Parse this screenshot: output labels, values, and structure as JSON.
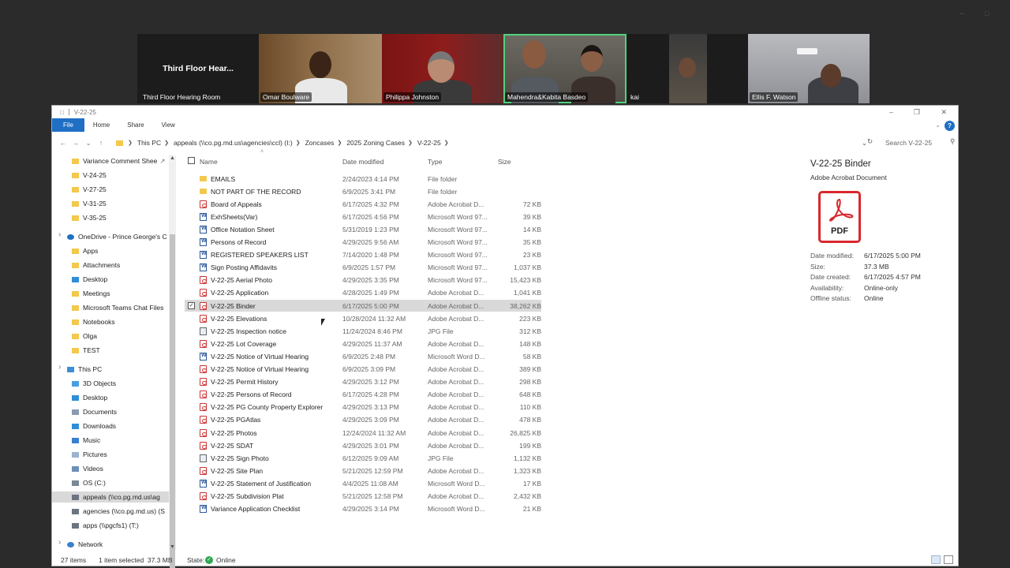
{
  "meeting": {
    "room_title": "Third Floor Hear...",
    "tiles": [
      "Third Floor Hearing Room",
      "Omar Boulware",
      "Philippa Johnston",
      "Mahendra&Kabita Basdeo",
      "kai",
      "Ellis F. Watson"
    ]
  },
  "window": {
    "title": "V-22-25",
    "ribbon_tabs": [
      "File",
      "Home",
      "Share",
      "View"
    ]
  },
  "address": {
    "crumbs": [
      "This PC",
      "appeals (\\\\co.pg.md.us\\agencies\\ccl) (I:)",
      "Zoncases",
      "2025 Zoning Cases",
      "V-22-25"
    ],
    "search_placeholder": "Search V-22-25"
  },
  "nav": [
    {
      "label": "Variance Comment Shee",
      "icon": "folder-icon",
      "pinned": true
    },
    {
      "label": "V-24-25",
      "icon": "folder-icon"
    },
    {
      "label": "V-27-25",
      "icon": "folder-icon"
    },
    {
      "label": "V-31-25",
      "icon": "folder-icon"
    },
    {
      "label": "V-35-25",
      "icon": "folder-icon"
    },
    {
      "label": "OneDrive - Prince George's C",
      "icon": "cloud-icon"
    },
    {
      "label": "Apps",
      "icon": "folder-icon"
    },
    {
      "label": "Attachments",
      "icon": "folder-icon"
    },
    {
      "label": "Desktop",
      "icon": "desktop-icon"
    },
    {
      "label": "Meetings",
      "icon": "folder-icon"
    },
    {
      "label": "Microsoft Teams Chat Files",
      "icon": "folder-icon"
    },
    {
      "label": "Notebooks",
      "icon": "folder-icon"
    },
    {
      "label": "Olga",
      "icon": "folder-icon"
    },
    {
      "label": "TEST",
      "icon": "folder-icon"
    },
    {
      "label": "This PC",
      "icon": "computer-icon"
    },
    {
      "label": "3D Objects",
      "icon": "cube-icon"
    },
    {
      "label": "Desktop",
      "icon": "desktop-icon"
    },
    {
      "label": "Documents",
      "icon": "documents-icon"
    },
    {
      "label": "Downloads",
      "icon": "download-icon"
    },
    {
      "label": "Music",
      "icon": "music-icon"
    },
    {
      "label": "Pictures",
      "icon": "pictures-icon"
    },
    {
      "label": "Videos",
      "icon": "videos-icon"
    },
    {
      "label": "OS (C:)",
      "icon": "drive-icon"
    },
    {
      "label": "appeals (\\\\co.pg.md.us\\ag",
      "icon": "network-drive-icon",
      "selected": true
    },
    {
      "label": "agencies (\\\\co.pg.md.us) (S",
      "icon": "network-drive-icon"
    },
    {
      "label": "apps (\\\\pgcfs1) (T:)",
      "icon": "network-drive-icon"
    },
    {
      "label": "Network",
      "icon": "network-icon"
    }
  ],
  "columns": {
    "name": "Name",
    "date": "Date modified",
    "type": "Type",
    "size": "Size"
  },
  "files": [
    {
      "name": "EMAILS",
      "date": "2/24/2023 4:14 PM",
      "type": "File folder",
      "size": "",
      "icon": "folder"
    },
    {
      "name": "NOT PART OF THE RECORD",
      "date": "6/9/2025 3:41 PM",
      "type": "File folder",
      "size": "",
      "icon": "folder"
    },
    {
      "name": "Board of Appeals",
      "date": "6/17/2025 4:32 PM",
      "type": "Adobe Acrobat D...",
      "size": "72 KB",
      "icon": "pdf"
    },
    {
      "name": "ExhSheets(Var)",
      "date": "6/17/2025 4:56 PM",
      "type": "Microsoft Word 97...",
      "size": "39 KB",
      "icon": "word"
    },
    {
      "name": "Office Notation Sheet",
      "date": "5/31/2019 1:23 PM",
      "type": "Microsoft Word 97...",
      "size": "14 KB",
      "icon": "word"
    },
    {
      "name": "Persons of Record",
      "date": "4/29/2025 9:56 AM",
      "type": "Microsoft Word 97...",
      "size": "35 KB",
      "icon": "word"
    },
    {
      "name": "REGISTERED SPEAKERS LIST",
      "date": "7/14/2020 1:48 PM",
      "type": "Microsoft Word 97...",
      "size": "23 KB",
      "icon": "word"
    },
    {
      "name": "Sign Posting Affidavits",
      "date": "6/9/2025 1:57 PM",
      "type": "Microsoft Word 97...",
      "size": "1,037 KB",
      "icon": "word"
    },
    {
      "name": "V-22-25 Aerial Photo",
      "date": "4/29/2025 3:35 PM",
      "type": "Microsoft Word 97...",
      "size": "15,423 KB",
      "icon": "pdf"
    },
    {
      "name": "V-22-25 Application",
      "date": "4/28/2025 1:49 PM",
      "type": "Adobe Acrobat D...",
      "size": "1,041 KB",
      "icon": "pdf"
    },
    {
      "name": "V-22-25 Binder",
      "date": "6/17/2025 5:00 PM",
      "type": "Adobe Acrobat D...",
      "size": "38,262 KB",
      "icon": "pdf",
      "selected": true
    },
    {
      "name": "V-22-25 Elevations",
      "date": "10/28/2024 11:32 AM",
      "type": "Adobe Acrobat D...",
      "size": "223 KB",
      "icon": "pdf"
    },
    {
      "name": "V-22-25 Inspection notice",
      "date": "11/24/2024 8:46 PM",
      "type": "JPG File",
      "size": "312 KB",
      "icon": "jpg"
    },
    {
      "name": "V-22-25 Lot Coverage",
      "date": "4/29/2025 11:37 AM",
      "type": "Adobe Acrobat D...",
      "size": "148 KB",
      "icon": "pdf"
    },
    {
      "name": "V-22-25 Notice of Virtual Hearing",
      "date": "6/9/2025 2:48 PM",
      "type": "Microsoft Word D...",
      "size": "58 KB",
      "icon": "word"
    },
    {
      "name": "V-22-25 Notice of Virtual Hearing",
      "date": "6/9/2025 3:09 PM",
      "type": "Adobe Acrobat D...",
      "size": "389 KB",
      "icon": "pdf"
    },
    {
      "name": "V-22-25 Permit History",
      "date": "4/29/2025 3:12 PM",
      "type": "Adobe Acrobat D...",
      "size": "298 KB",
      "icon": "pdf"
    },
    {
      "name": "V-22-25 Persons of Record",
      "date": "6/17/2025 4:28 PM",
      "type": "Adobe Acrobat D...",
      "size": "648 KB",
      "icon": "pdf"
    },
    {
      "name": "V-22-25 PG County Property Explorer",
      "date": "4/29/2025 3:13 PM",
      "type": "Adobe Acrobat D...",
      "size": "110 KB",
      "icon": "pdf"
    },
    {
      "name": "V-22-25 PGAtlas",
      "date": "4/29/2025 3:09 PM",
      "type": "Adobe Acrobat D...",
      "size": "478 KB",
      "icon": "pdf"
    },
    {
      "name": "V-22-25 Photos",
      "date": "12/24/2024 11:32 AM",
      "type": "Adobe Acrobat D...",
      "size": "26,825 KB",
      "icon": "pdf"
    },
    {
      "name": "V-22-25 SDAT",
      "date": "4/29/2025 3:01 PM",
      "type": "Adobe Acrobat D...",
      "size": "199 KB",
      "icon": "pdf"
    },
    {
      "name": "V-22-25 Sign Photo",
      "date": "6/12/2025 9:09 AM",
      "type": "JPG File",
      "size": "1,132 KB",
      "icon": "jpg"
    },
    {
      "name": "V-22-25 Site Plan",
      "date": "5/21/2025 12:59 PM",
      "type": "Adobe Acrobat D...",
      "size": "1,323 KB",
      "icon": "pdf"
    },
    {
      "name": "V-22-25 Statement of Justification",
      "date": "4/4/2025 11:08 AM",
      "type": "Microsoft Word D...",
      "size": "17 KB",
      "icon": "word"
    },
    {
      "name": "V-22-25 Subdivision Plat",
      "date": "5/21/2025 12:58 PM",
      "type": "Adobe Acrobat D...",
      "size": "2,432 KB",
      "icon": "pdf"
    },
    {
      "name": "Variance Application Checklist",
      "date": "4/29/2025 3:14 PM",
      "type": "Microsoft Word D...",
      "size": "21 KB",
      "icon": "word"
    }
  ],
  "details": {
    "title": "V-22-25 Binder",
    "subtitle": "Adobe Acrobat Document",
    "icon_label": "PDF",
    "props": [
      {
        "k": "Date modified:",
        "v": "6/17/2025 5:00 PM"
      },
      {
        "k": "Size:",
        "v": "37.3 MB"
      },
      {
        "k": "Date created:",
        "v": "6/17/2025 4:57 PM"
      },
      {
        "k": "Availability:",
        "v": "Online-only"
      },
      {
        "k": "Offline status:",
        "v": "Online"
      }
    ]
  },
  "status": {
    "count": "27 items",
    "selected": "1 item selected  37.3 MB",
    "state_label": "State:",
    "state_value": "Online"
  },
  "colors": {
    "accent": "#1f6fc5",
    "pdf": "#d9272e",
    "active_speaker": "#4fd27a",
    "selected_row": "#d9d9d9"
  }
}
